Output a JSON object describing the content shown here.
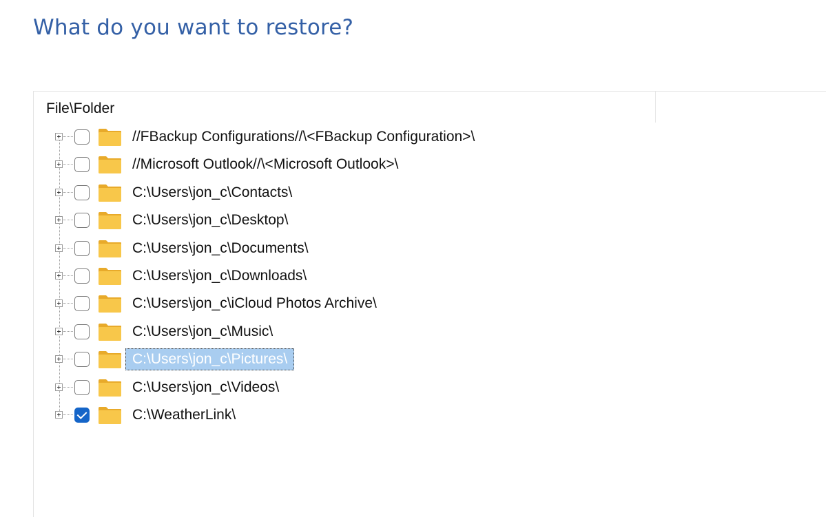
{
  "page": {
    "title": "What do you want to restore?"
  },
  "tree": {
    "column_header": "File\\Folder",
    "items": [
      {
        "label": "//FBackup Configurations//\\<FBackup Configuration>\\",
        "checked": false,
        "selected": false
      },
      {
        "label": "//Microsoft Outlook//\\<Microsoft Outlook>\\",
        "checked": false,
        "selected": false
      },
      {
        "label": "C:\\Users\\jon_c\\Contacts\\",
        "checked": false,
        "selected": false
      },
      {
        "label": "C:\\Users\\jon_c\\Desktop\\",
        "checked": false,
        "selected": false
      },
      {
        "label": "C:\\Users\\jon_c\\Documents\\",
        "checked": false,
        "selected": false
      },
      {
        "label": "C:\\Users\\jon_c\\Downloads\\",
        "checked": false,
        "selected": false
      },
      {
        "label": "C:\\Users\\jon_c\\iCloud Photos Archive\\",
        "checked": false,
        "selected": false
      },
      {
        "label": "C:\\Users\\jon_c\\Music\\",
        "checked": false,
        "selected": false
      },
      {
        "label": "C:\\Users\\jon_c\\Pictures\\",
        "checked": false,
        "selected": true
      },
      {
        "label": "C:\\Users\\jon_c\\Videos\\",
        "checked": false,
        "selected": false
      },
      {
        "label": "C:\\WeatherLink\\",
        "checked": true,
        "selected": false
      }
    ]
  },
  "icons": {
    "expander": "plus-box-icon",
    "folder": "folder-icon",
    "checkbox": "checkbox-icon"
  },
  "colors": {
    "title": "#3460a6",
    "folder_body": "#f8c74a",
    "folder_tab": "#e8aa2a",
    "checkbox_checked": "#1565c8",
    "selection_bg": "#a9cdf0"
  }
}
